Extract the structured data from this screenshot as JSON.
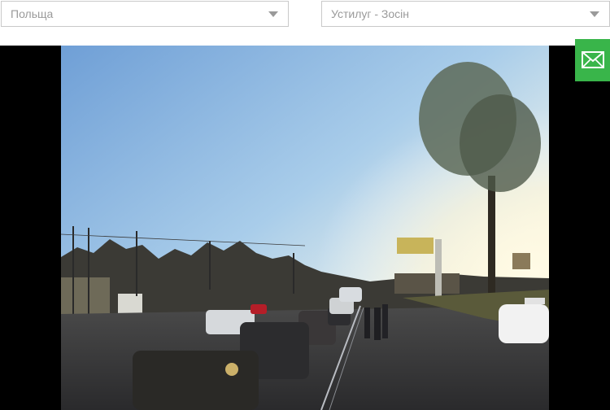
{
  "filters": {
    "country": {
      "value": "Польща",
      "icon": "chevron-down-icon"
    },
    "crossing": {
      "value": "Устилуг - Зосін",
      "icon": "chevron-down-icon"
    }
  },
  "contact_button": {
    "icon": "envelope-icon",
    "color": "#39b54a"
  },
  "camera": {
    "content": "live border-crossing camera image"
  }
}
